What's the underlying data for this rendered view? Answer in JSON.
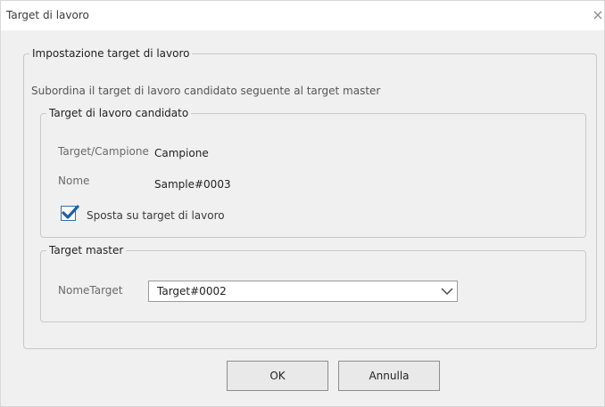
{
  "window": {
    "title": "Target di lavoro",
    "close_glyph": "×"
  },
  "group_main": {
    "legend": "Impostazione target di lavoro",
    "description": "Subordina il target di lavoro candidato seguente al target master"
  },
  "group_candidate": {
    "legend": "Target di lavoro candidato",
    "target_label": "Target/Campione",
    "target_value": "Campione",
    "name_label": "Nome",
    "name_value": "Sample#0003",
    "move_checkbox_label": "Sposta su target di lavoro",
    "move_checked": true
  },
  "group_master": {
    "legend": "Target master",
    "name_label": "NomeTarget",
    "selected_value": "Target#0002"
  },
  "buttons": {
    "ok": "OK",
    "cancel": "Annulla"
  },
  "icons": {
    "close": "close-icon",
    "checkmark": "checkmark-icon",
    "dropdown": "chevron-down-icon"
  },
  "colors": {
    "dialog_background": "#f0f0f0",
    "checkmark": "#1f5fa6"
  }
}
